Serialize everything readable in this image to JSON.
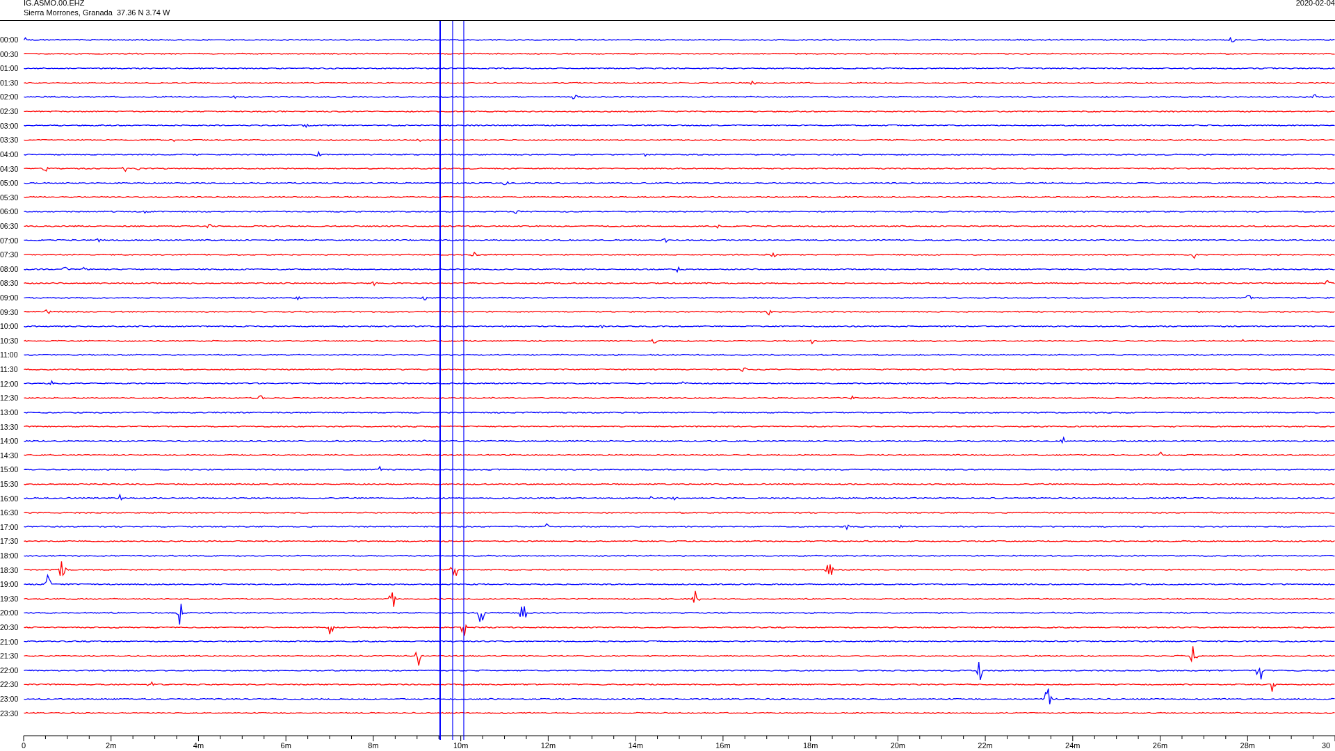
{
  "header": {
    "station": "IG.ASMO.00.EHZ",
    "location": "Sierra Morrones, Granada  37.36 N 3.74 W",
    "date": "2020-02-04"
  },
  "rows": [
    {
      "label": "00:00",
      "color": "#0000ff"
    },
    {
      "label": "00:30",
      "color": "#ff0000"
    },
    {
      "label": "01:00",
      "color": "#0000ff"
    },
    {
      "label": "01:30",
      "color": "#ff0000"
    },
    {
      "label": "02:00",
      "color": "#0000ff"
    },
    {
      "label": "02:30",
      "color": "#ff0000"
    },
    {
      "label": "03:00",
      "color": "#0000ff"
    },
    {
      "label": "03:30",
      "color": "#ff0000"
    },
    {
      "label": "04:00",
      "color": "#0000ff"
    },
    {
      "label": "04:30",
      "color": "#ff0000"
    },
    {
      "label": "05:00",
      "color": "#0000ff"
    },
    {
      "label": "05:30",
      "color": "#ff0000"
    },
    {
      "label": "06:00",
      "color": "#0000ff"
    },
    {
      "label": "06:30",
      "color": "#ff0000"
    },
    {
      "label": "07:00",
      "color": "#0000ff"
    },
    {
      "label": "07:30",
      "color": "#ff0000"
    },
    {
      "label": "08:00",
      "color": "#0000ff"
    },
    {
      "label": "08:30",
      "color": "#ff0000"
    },
    {
      "label": "09:00",
      "color": "#0000ff"
    },
    {
      "label": "09:30",
      "color": "#ff0000"
    },
    {
      "label": "10:00",
      "color": "#0000ff"
    },
    {
      "label": "10:30",
      "color": "#ff0000"
    },
    {
      "label": "11:00",
      "color": "#0000ff"
    },
    {
      "label": "11:30",
      "color": "#ff0000"
    },
    {
      "label": "12:00",
      "color": "#0000ff"
    },
    {
      "label": "12:30",
      "color": "#ff0000"
    },
    {
      "label": "13:00",
      "color": "#0000ff"
    },
    {
      "label": "13:30",
      "color": "#ff0000"
    },
    {
      "label": "14:00",
      "color": "#0000ff"
    },
    {
      "label": "14:30",
      "color": "#ff0000"
    },
    {
      "label": "15:00",
      "color": "#0000ff"
    },
    {
      "label": "15:30",
      "color": "#ff0000"
    },
    {
      "label": "16:00",
      "color": "#0000ff"
    },
    {
      "label": "16:30",
      "color": "#ff0000"
    },
    {
      "label": "17:00",
      "color": "#0000ff"
    },
    {
      "label": "17:30",
      "color": "#ff0000"
    },
    {
      "label": "18:00",
      "color": "#0000ff"
    },
    {
      "label": "18:30",
      "color": "#ff0000"
    },
    {
      "label": "19:00",
      "color": "#0000ff"
    },
    {
      "label": "19:30",
      "color": "#ff0000"
    },
    {
      "label": "20:00",
      "color": "#0000ff"
    },
    {
      "label": "20:30",
      "color": "#ff0000"
    },
    {
      "label": "21:00",
      "color": "#0000ff"
    },
    {
      "label": "21:30",
      "color": "#ff0000"
    },
    {
      "label": "22:00",
      "color": "#0000ff"
    },
    {
      "label": "22:30",
      "color": "#ff0000"
    },
    {
      "label": "23:00",
      "color": "#0000ff"
    },
    {
      "label": "23:30",
      "color": "#ff0000"
    }
  ],
  "x_axis": {
    "labels": [
      "0",
      "2m",
      "4m",
      "6m",
      "8m",
      "10m",
      "12m",
      "14m",
      "16m",
      "18m",
      "20m",
      "22m",
      "24m",
      "26m",
      "28m",
      "30"
    ]
  }
}
